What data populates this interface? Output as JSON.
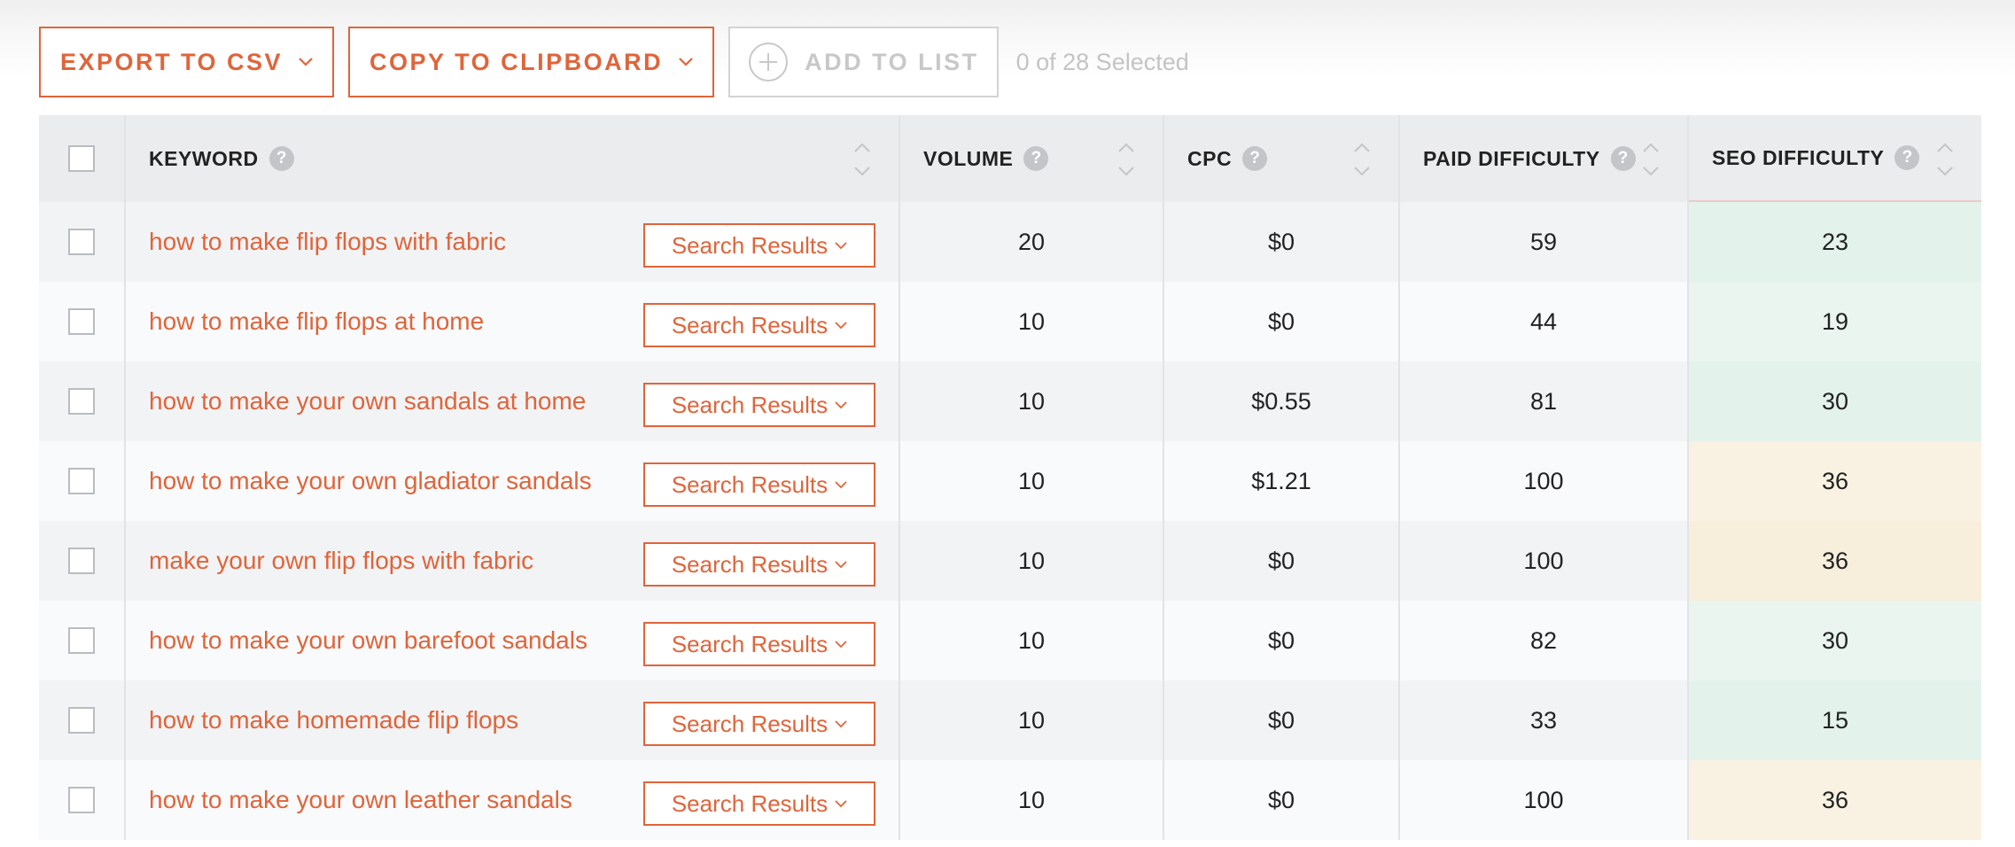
{
  "toolbar": {
    "export_label": "EXPORT TO CSV",
    "copy_label": "COPY TO CLIPBOARD",
    "add_label": "ADD TO LIST",
    "selected_text": "0 of 28 Selected"
  },
  "table": {
    "headers": {
      "keyword": "KEYWORD",
      "volume": "VOLUME",
      "cpc": "CPC",
      "paid_difficulty": "PAID DIFFICULTY",
      "seo_difficulty": "SEO DIFFICULTY"
    },
    "help_glyph": "?",
    "search_results_label": "Search Results",
    "rows": [
      {
        "keyword": "how to make flip flops with fabric",
        "volume": "20",
        "cpc": "$0",
        "paid": "59",
        "seo": "23",
        "seo_level": "green"
      },
      {
        "keyword": "how to make flip flops at home",
        "volume": "10",
        "cpc": "$0",
        "paid": "44",
        "seo": "19",
        "seo_level": "green"
      },
      {
        "keyword": "how to make your own sandals at home",
        "volume": "10",
        "cpc": "$0.55",
        "paid": "81",
        "seo": "30",
        "seo_level": "green"
      },
      {
        "keyword": "how to make your own gladiator sandals",
        "volume": "10",
        "cpc": "$1.21",
        "paid": "100",
        "seo": "36",
        "seo_level": "yellow"
      },
      {
        "keyword": "make your own flip flops with fabric",
        "volume": "10",
        "cpc": "$0",
        "paid": "100",
        "seo": "36",
        "seo_level": "yellow"
      },
      {
        "keyword": "how to make your own barefoot sandals",
        "volume": "10",
        "cpc": "$0",
        "paid": "82",
        "seo": "30",
        "seo_level": "green"
      },
      {
        "keyword": "how to make homemade flip flops",
        "volume": "10",
        "cpc": "$0",
        "paid": "33",
        "seo": "15",
        "seo_level": "green"
      },
      {
        "keyword": "how to make your own leather sandals",
        "volume": "10",
        "cpc": "$0",
        "paid": "100",
        "seo": "36",
        "seo_level": "yellow"
      }
    ]
  },
  "colors": {
    "accent": "#e0643a",
    "seo_green": "#e4f2ec",
    "seo_yellow": "#f7eedc"
  },
  "icons": {
    "dropdown": "chevron-down-icon",
    "add": "plus-circle-icon",
    "help": "question-icon",
    "sort": "sort-icon"
  }
}
